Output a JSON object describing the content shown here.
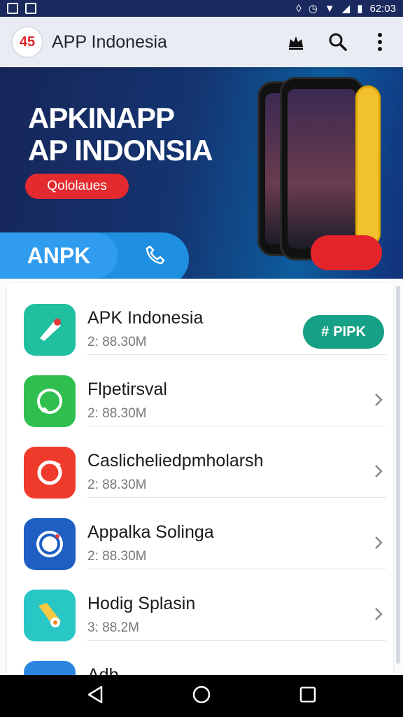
{
  "status_bar": {
    "time": "62:03"
  },
  "app_bar": {
    "logo_text": "45",
    "title": "APP Indonesia"
  },
  "banner": {
    "headline_line1": "APKINAPP",
    "headline_line2": "AP INDONSIA",
    "pill_label": "Qololaues",
    "cta_label": "ANPK"
  },
  "apps": [
    {
      "name": "APK Indonesia",
      "size": "2: 88.30M",
      "action": "PIPK",
      "color": "#1fbfa0"
    },
    {
      "name": "Flpetirsval",
      "size": "2: 88.30M",
      "color": "#2fbf4f"
    },
    {
      "name": "Caslicheliedpmholarsh",
      "size": "2: 88.30M",
      "color": "#ef3b2c"
    },
    {
      "name": "Appalka Solinga",
      "size": "2: 88.30M",
      "color": "#1f5fc4"
    },
    {
      "name": "Hodig Splasin",
      "size": "3: 88.2M",
      "color": "#29c6c6"
    },
    {
      "name": "Adb",
      "size": "",
      "color": "#2a86e0"
    }
  ]
}
